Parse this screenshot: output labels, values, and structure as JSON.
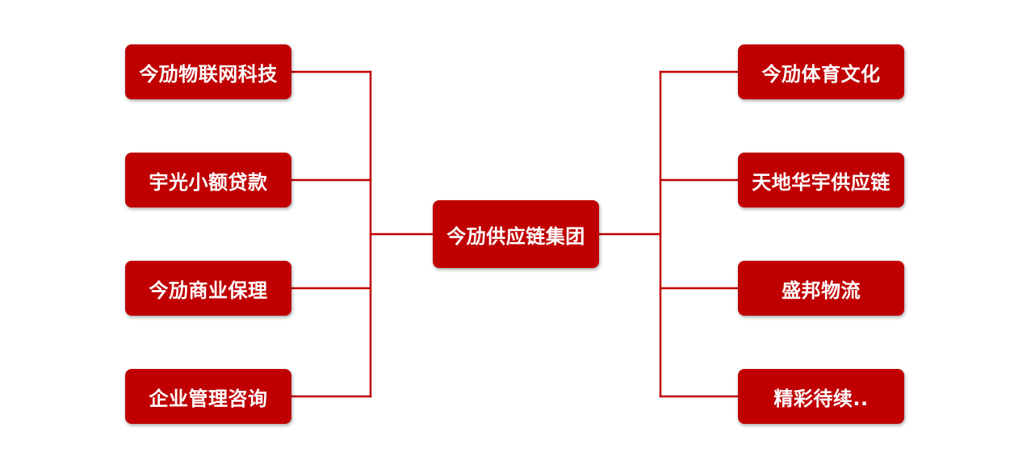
{
  "colors": {
    "node": "#c00000",
    "line": "#c00000",
    "text": "#ffffff",
    "background": "#ffffff"
  },
  "center": {
    "label": "今劢供应链集团"
  },
  "left_nodes": [
    {
      "label": "今劢物联网科技"
    },
    {
      "label": "宇光小额贷款"
    },
    {
      "label": "今劢商业保理"
    },
    {
      "label": "企业管理咨询"
    }
  ],
  "right_nodes": [
    {
      "label": "今劢体育文化"
    },
    {
      "label": "天地华宇供应链"
    },
    {
      "label": "盛邦物流"
    },
    {
      "label": "精彩待续.."
    }
  ]
}
